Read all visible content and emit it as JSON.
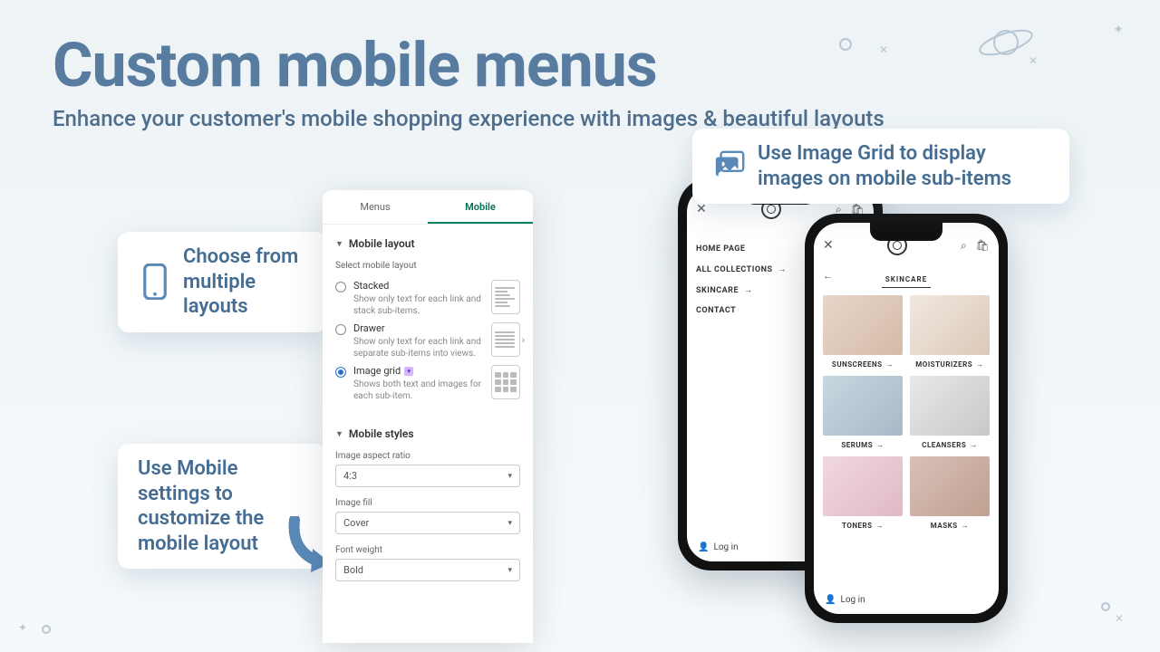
{
  "heading": {
    "title": "Custom mobile menus",
    "subtitle": "Enhance your customer's mobile shopping experience with images & beautiful layouts"
  },
  "callouts": {
    "layouts": "Choose from multiple layouts",
    "settings": "Use Mobile settings to customize the mobile layout",
    "imagegrid": "Use Image Grid to display images on mobile sub-items"
  },
  "panel": {
    "tabs": {
      "menus": "Menus",
      "mobile": "Mobile"
    },
    "sections": {
      "layout": "Mobile layout",
      "styles": "Mobile styles"
    },
    "select_label": "Select mobile layout",
    "options": {
      "stacked": {
        "title": "Stacked",
        "desc": "Show only text for each link and stack sub-items."
      },
      "drawer": {
        "title": "Drawer",
        "desc": "Show only text for each link and separate sub-items into views."
      },
      "grid": {
        "title": "Image grid",
        "desc": "Shows both text and images for each sub-item."
      }
    },
    "fields": {
      "aspect": {
        "label": "Image aspect ratio",
        "value": "4:3"
      },
      "fill": {
        "label": "Image fill",
        "value": "Cover"
      },
      "weight": {
        "label": "Font weight",
        "value": "Bold"
      }
    }
  },
  "phone1": {
    "nav": [
      "HOME PAGE",
      "ALL COLLECTIONS",
      "SKINCARE",
      "CONTACT"
    ],
    "login": "Log in"
  },
  "phone2": {
    "crumb": "SKINCARE",
    "items": [
      "SUNSCREENS",
      "MOISTURIZERS",
      "SERUMS",
      "CLEANSERS",
      "TONERS",
      "MASKS"
    ],
    "login": "Log in"
  }
}
